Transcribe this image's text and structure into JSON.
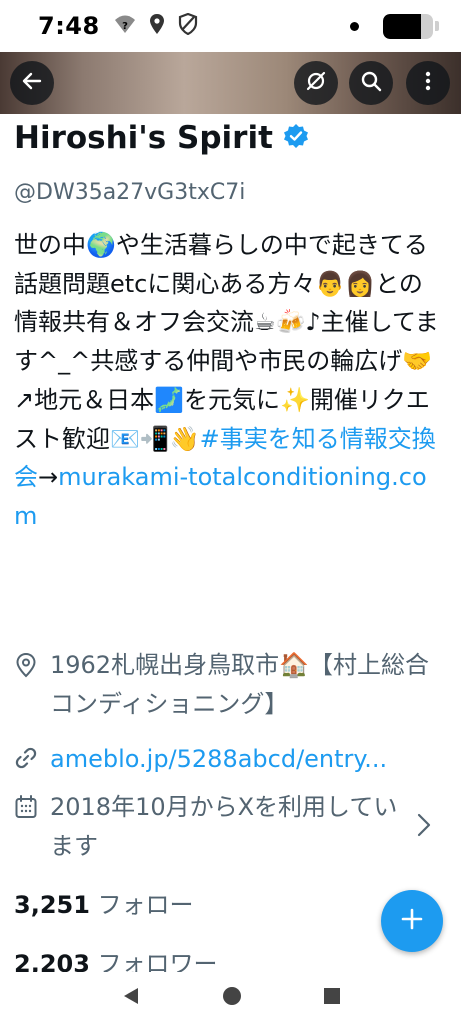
{
  "status": {
    "time": "7:48",
    "wifi_icon": "wifi-question-icon",
    "location_icon": "location-icon",
    "shield_icon": "shield-icon",
    "battery_level": 0.75
  },
  "toolbar": {
    "back_icon": "back-arrow-icon",
    "hide_icon": "eye-off-icon",
    "search_icon": "search-icon",
    "more_icon": "more-vertical-icon"
  },
  "profile": {
    "name": "Hiroshi's Spirit",
    "handle": "@DW35a27vG3txC7i",
    "bio_text": "世の中🌍や生活暮らしの中で起きてる話題問題etcに関心ある方々👨👩との情報共有＆オフ会交流☕🍻♪主催してます^_^共感する仲間や市民の輪広げ🤝↗地元＆日本🗾を元気に✨開催リクエスト歓迎📧📲👋",
    "bio_hashtag": "#事実を知る情報交換会",
    "bio_arrow": "→",
    "bio_link": "murakami-totalconditioning.com",
    "location": "1962札幌出身鳥取市🏠【村上総合コンディショニング】",
    "website": "ameblo.jp/5288abcd/entry...",
    "joined": "2018年10月からXを利用しています",
    "following_count": "3,251",
    "following_label": "フォロー",
    "followers_count": "2,203",
    "followers_label": "フォロワー"
  },
  "colors": {
    "accent": "#1d9bf0",
    "text": "#0f1419",
    "secondary": "#536471"
  }
}
